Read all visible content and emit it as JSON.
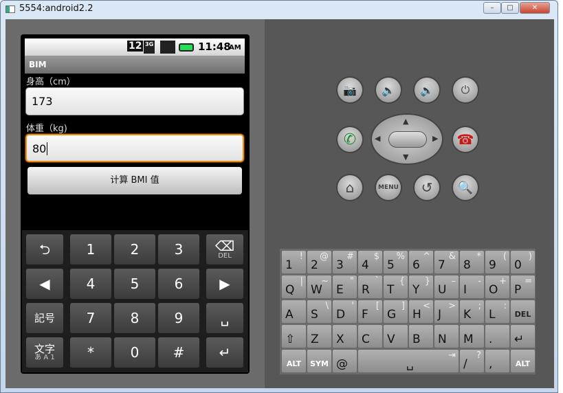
{
  "window": {
    "title": "5554:android2.2",
    "minimize": "–",
    "maximize": "□",
    "close": "✕"
  },
  "status_bar": {
    "notification_count": "12",
    "network": "3G",
    "time": "11:48",
    "ampm": "AM"
  },
  "app": {
    "title": "BIM",
    "height_label": "身高（cm）",
    "height_value": "173",
    "weight_label": "体重（kg)",
    "weight_value": "80",
    "calc_button": "计算 BMI 值"
  },
  "soft_keyboard": {
    "rows": [
      [
        {
          "k": "⮌",
          "n": "undo"
        },
        {
          "k": "1"
        },
        {
          "k": "2"
        },
        {
          "k": "3"
        },
        {
          "k": "⌫",
          "s": "DEL",
          "n": "delete"
        }
      ],
      [
        {
          "k": "◀",
          "n": "left"
        },
        {
          "k": "4"
        },
        {
          "k": "5"
        },
        {
          "k": "6"
        },
        {
          "k": "▶",
          "n": "right"
        }
      ],
      [
        {
          "k": "記号",
          "n": "symbols"
        },
        {
          "k": "7"
        },
        {
          "k": "8"
        },
        {
          "k": "9"
        },
        {
          "k": "␣",
          "n": "space"
        }
      ],
      [
        {
          "k": "文字",
          "s": "あ A 1",
          "n": "input-mode"
        },
        {
          "k": "*"
        },
        {
          "k": "0"
        },
        {
          "k": "#"
        },
        {
          "k": "↵",
          "n": "enter"
        }
      ]
    ]
  },
  "hw_keyboard": {
    "rows": [
      [
        [
          "1",
          "!"
        ],
        [
          "2",
          "@"
        ],
        [
          "3",
          "#"
        ],
        [
          "4",
          "$"
        ],
        [
          "5",
          "%"
        ],
        [
          "6",
          "^"
        ],
        [
          "7",
          "&"
        ],
        [
          "8",
          "*"
        ],
        [
          "9",
          "("
        ],
        [
          "0",
          ")"
        ]
      ],
      [
        [
          "Q",
          "|"
        ],
        [
          "W",
          "~"
        ],
        [
          "E",
          "\""
        ],
        [
          "R",
          "`"
        ],
        [
          "T",
          "{"
        ],
        [
          "Y",
          "}"
        ],
        [
          "U",
          "–"
        ],
        [
          "I",
          "-"
        ],
        [
          "O",
          "+"
        ],
        [
          "P",
          "="
        ]
      ],
      [
        [
          "A",
          ""
        ],
        [
          "S",
          "\\"
        ],
        [
          "D",
          "'"
        ],
        [
          "F",
          "["
        ],
        [
          "G",
          "]"
        ],
        [
          "H",
          "<"
        ],
        [
          "J",
          ">"
        ],
        [
          "K",
          ";"
        ],
        [
          "L",
          ":"
        ],
        [
          "DEL",
          ""
        ]
      ],
      [
        [
          "⇧",
          ""
        ],
        [
          "Z",
          ""
        ],
        [
          "X",
          ""
        ],
        [
          "C",
          ""
        ],
        [
          "V",
          ""
        ],
        [
          "B",
          ""
        ],
        [
          "N",
          ""
        ],
        [
          "M",
          ""
        ],
        [
          ".",
          ""
        ],
        [
          "↵",
          ""
        ]
      ],
      [
        [
          "ALT",
          ""
        ],
        [
          "SYM",
          ""
        ],
        [
          "@",
          ""
        ],
        [
          "␣",
          "⇥"
        ],
        [
          "/",
          "?"
        ],
        [
          ",",
          ""
        ],
        [
          "ALT",
          ""
        ]
      ]
    ]
  },
  "controls": {
    "menu": "MENU"
  },
  "colors": {
    "focus": "#f08a16",
    "call": "#1a8a2a",
    "endcall": "#c81818"
  }
}
